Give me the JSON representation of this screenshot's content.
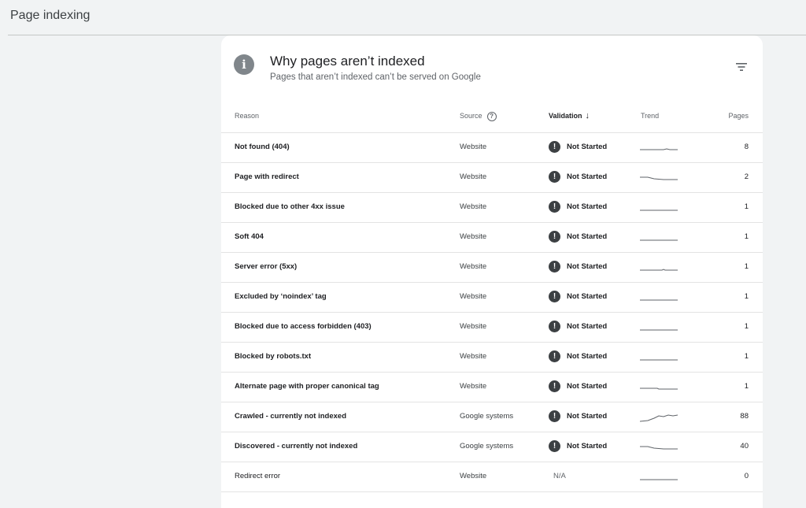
{
  "header": {
    "title": "Page indexing"
  },
  "card": {
    "title": "Why pages aren’t indexed",
    "subtitle": "Pages that aren’t indexed can’t be served on Google",
    "info_icon": "info-icon",
    "filter_icon": "filter-icon"
  },
  "table": {
    "columns": {
      "reason": "Reason",
      "source": "Source",
      "validation": "Validation",
      "trend": "Trend",
      "pages": "Pages"
    },
    "rows": [
      {
        "reason": "Not found (404)",
        "source": "Website",
        "validation": "Not Started",
        "pages": "8",
        "trend": "flat-bump"
      },
      {
        "reason": "Page with redirect",
        "source": "Website",
        "validation": "Not Started",
        "pages": "2",
        "trend": "slight-decline"
      },
      {
        "reason": "Blocked due to other 4xx issue",
        "source": "Website",
        "validation": "Not Started",
        "pages": "1",
        "trend": "flat"
      },
      {
        "reason": "Soft 404",
        "source": "Website",
        "validation": "Not Started",
        "pages": "1",
        "trend": "flat"
      },
      {
        "reason": "Server error (5xx)",
        "source": "Website",
        "validation": "Not Started",
        "pages": "1",
        "trend": "flat-blip"
      },
      {
        "reason": "Excluded by ‘noindex’ tag",
        "source": "Website",
        "validation": "Not Started",
        "pages": "1",
        "trend": "flat"
      },
      {
        "reason": "Blocked due to access forbidden (403)",
        "source": "Website",
        "validation": "Not Started",
        "pages": "1",
        "trend": "flat"
      },
      {
        "reason": "Blocked by robots.txt",
        "source": "Website",
        "validation": "Not Started",
        "pages": "1",
        "trend": "flat"
      },
      {
        "reason": "Alternate page with proper canonical tag",
        "source": "Website",
        "validation": "Not Started",
        "pages": "1",
        "trend": "flat-step"
      },
      {
        "reason": "Crawled - currently not indexed",
        "source": "Google systems",
        "validation": "Not Started",
        "pages": "88",
        "trend": "rising"
      },
      {
        "reason": "Discovered - currently not indexed",
        "source": "Google systems",
        "validation": "Not Started",
        "pages": "40",
        "trend": "slight-decline"
      },
      {
        "reason": "Redirect error",
        "source": "Website",
        "validation": "N/A",
        "pages": "0",
        "trend": "flat",
        "plain": true
      }
    ]
  },
  "colors": {
    "background": "#f1f3f4",
    "card": "#ffffff",
    "status_icon": "#3c4043",
    "divider": "#e3e3e3"
  }
}
